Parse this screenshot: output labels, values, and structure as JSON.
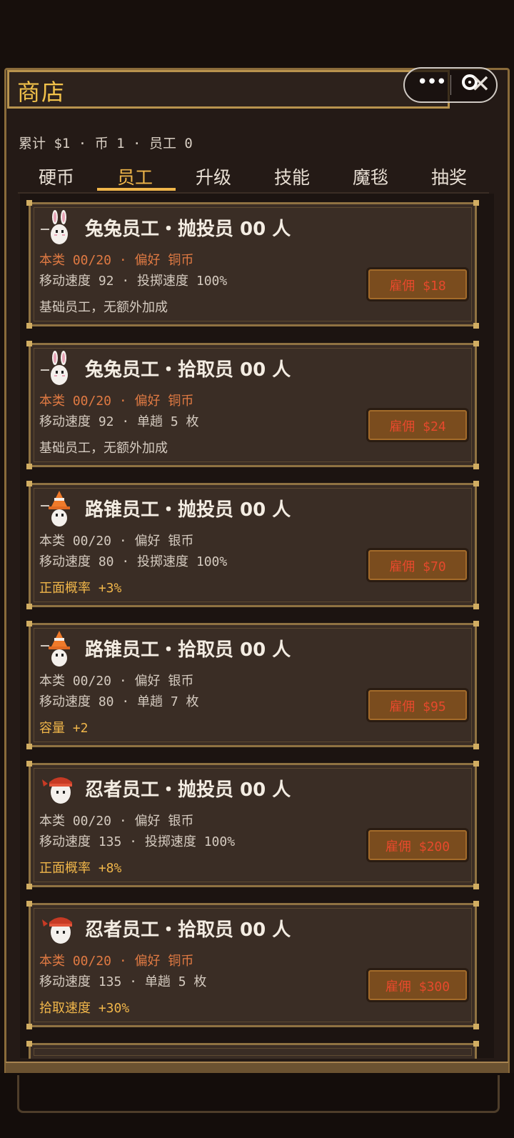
{
  "window": {
    "title": "商店"
  },
  "capsule": {
    "more": "•••"
  },
  "stats": {
    "total": "累计 $1",
    "coins": "币 1",
    "staff": "员工 0",
    "sep": "·"
  },
  "tabs": [
    "硬币",
    "员工",
    "升级",
    "技能",
    "魔毯",
    "抽奖"
  ],
  "active_tab": "员工",
  "cards": [
    {
      "title": "兔兔员工・抛投员 00 人",
      "avatar": "rabbit-icon",
      "line1": "本类 00/20 · 偏好 铜币",
      "line1_color": "#e07a43",
      "line2": "移动速度 92 · 投掷速度 100%",
      "line3": "基础员工，无额外加成",
      "line3_color": "#d5cbc0",
      "hire": "雇佣 $18"
    },
    {
      "title": "兔兔员工・拾取员 00 人",
      "avatar": "rabbit-icon",
      "line1": "本类 00/20 · 偏好 铜币",
      "line1_color": "#e07a43",
      "line2": "移动速度 92 · 单趟 5 枚",
      "line3": "基础员工，无额外加成",
      "line3_color": "#d5cbc0",
      "hire": "雇佣 $24"
    },
    {
      "title": "路锥员工・抛投员 00 人",
      "avatar": "traffic-cone-icon",
      "line1": "本类 00/20 · 偏好 银币",
      "line1_color": "#d5cbc0",
      "line2": "移动速度 80 · 投掷速度 100%",
      "line3": "正面概率 +3%",
      "line3_color": "#f0b64a",
      "hire": "雇佣 $70"
    },
    {
      "title": "路锥员工・拾取员 00 人",
      "avatar": "traffic-cone-icon",
      "line1": "本类 00/20 · 偏好 银币",
      "line1_color": "#d5cbc0",
      "line2": "移动速度 80 · 单趟 7 枚",
      "line3": "容量 +2",
      "line3_color": "#f0b64a",
      "hire": "雇佣 $95"
    },
    {
      "title": "忍者员工・抛投员 00 人",
      "avatar": "ninja-icon",
      "line1": "本类 00/20 · 偏好 银币",
      "line1_color": "#d5cbc0",
      "line2": "移动速度 135 · 投掷速度 100%",
      "line3": "正面概率 +8%",
      "line3_color": "#f0b64a",
      "hire": "雇佣 $200"
    },
    {
      "title": "忍者员工・拾取员 00 人",
      "avatar": "ninja-icon",
      "line1": "本类 00/20 · 偏好 铜币",
      "line1_color": "#e07a43",
      "line2": "移动速度 135 · 单趟 5 枚",
      "line3": "拾取速度 +30%",
      "line3_color": "#f0b64a",
      "hire": "雇佣 $300"
    }
  ]
}
